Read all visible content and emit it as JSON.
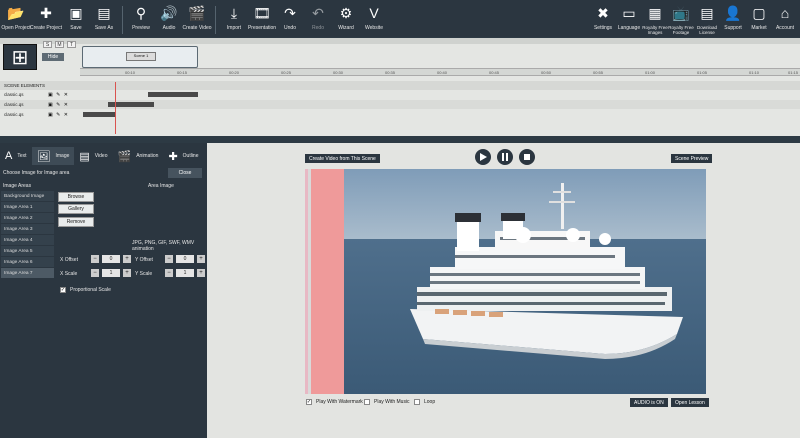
{
  "toolbar": {
    "left": [
      {
        "label": "Open Project",
        "icon": "folder-open-icon"
      },
      {
        "label": "Create Project",
        "icon": "new-project-icon"
      },
      {
        "label": "Save",
        "icon": "save-icon"
      },
      {
        "label": "Save As",
        "icon": "save-as-icon"
      },
      {
        "label": "Preview",
        "icon": "search-icon"
      },
      {
        "label": "Audio",
        "icon": "speaker-icon"
      },
      {
        "label": "Create Video",
        "icon": "clapper-icon"
      },
      {
        "label": "Import",
        "icon": "download-icon"
      },
      {
        "label": "Presentation",
        "icon": "presentation-icon"
      },
      {
        "label": "Undo",
        "icon": "undo-icon"
      },
      {
        "label": "Redo",
        "icon": "redo-icon"
      },
      {
        "label": "Wizard",
        "icon": "wizard-icon"
      },
      {
        "label": "Website",
        "icon": "website-icon"
      }
    ],
    "right": [
      {
        "label": "Settings",
        "icon": "tools-icon"
      },
      {
        "label": "Language",
        "icon": "language-icon"
      },
      {
        "label": "Royalty Free Images",
        "icon": "images-icon"
      },
      {
        "label": "Royalty Free Footage",
        "icon": "footage-icon"
      },
      {
        "label": "Download License",
        "icon": "license-icon"
      },
      {
        "label": "Support",
        "icon": "support-icon"
      },
      {
        "label": "Market",
        "icon": "market-icon"
      },
      {
        "label": "Account",
        "icon": "home-icon"
      }
    ]
  },
  "timeline": {
    "scene_label": "Scene 1",
    "hide_label": "Hide",
    "section_label": "SCENE ELEMENTS",
    "ruler_marks": [
      "00:10",
      "00:15",
      "00:20",
      "00:25",
      "00:30",
      "00:35",
      "00:40",
      "00:45",
      "00:50",
      "00:55",
      "01:00",
      "01:05",
      "01:10",
      "01:15"
    ],
    "rows": [
      {
        "name": "classic.qs",
        "controls": "▣ ✎ ✕"
      },
      {
        "name": "classic.qs",
        "controls": "▣ ✎ ✕"
      },
      {
        "name": "classic.qs",
        "controls": "▣ ✎ ✕"
      }
    ],
    "small_buttons": [
      "S",
      "M",
      "T"
    ]
  },
  "left_panel": {
    "tabs": [
      {
        "label": "Text",
        "icon": "text-icon"
      },
      {
        "label": "Image",
        "icon": "image-icon"
      },
      {
        "label": "Video",
        "icon": "video-icon"
      },
      {
        "label": "Animation",
        "icon": "animation-icon"
      },
      {
        "label": "Outline",
        "icon": "puzzle-icon"
      }
    ],
    "choose_label": "Choose Image for Image area",
    "close_label": "Close",
    "image_areas_label": "Image Areas",
    "area_image_label": "Area Image",
    "browse_label": "Browse",
    "gallery_label": "Gallery",
    "remove_label": "Remove",
    "formats_label": "JPG, PNG, GIF, SWF, WMV animation",
    "areas": [
      "Background Image",
      "Image Area 1",
      "Image Area 2",
      "Image Area 3",
      "Image Area 4",
      "Image Area 5",
      "Image Area 6",
      "Image Area 7"
    ],
    "x_offset_label": "X Offset",
    "y_offset_label": "Y Offset",
    "x_scale_label": "X Scale",
    "y_scale_label": "Y Scale",
    "x_offset": "0",
    "y_offset": "0",
    "x_scale": "1",
    "y_scale": "1",
    "proportional_label": "Proportional Scale"
  },
  "preview": {
    "create_video_label": "Create Video from This Scene",
    "scene_preview_label": "Scene Preview",
    "play_watermark_label": "Play With Watermark",
    "play_music_label": "Play With Music",
    "loop_label": "Loop",
    "audio_label": "AUDIO is ON",
    "open_lesson_label": "Open Lesson"
  }
}
